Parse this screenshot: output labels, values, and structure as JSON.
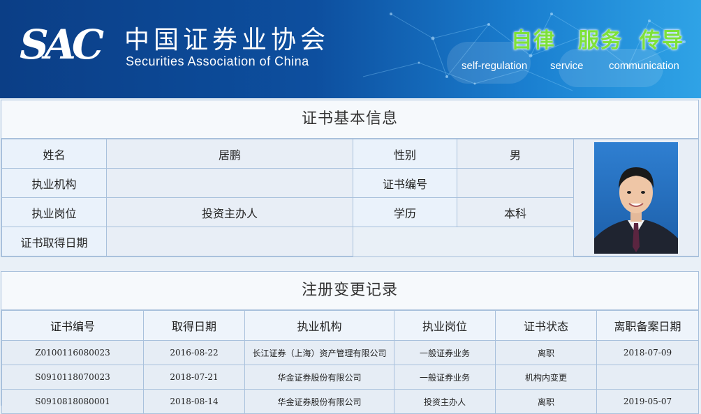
{
  "header": {
    "logo_text": "SAC",
    "org_name_cn": "中国证券业协会",
    "org_name_en": "Securities Association of China",
    "slogans": [
      {
        "cn": "自律",
        "en": "self-regulation"
      },
      {
        "cn": "服务",
        "en": "service"
      },
      {
        "cn": "传导",
        "en": "communication"
      }
    ],
    "colors": {
      "bg_dark": "#0b3e86",
      "bg_light": "#2fa3e6",
      "slogan_green": "#7ee13a"
    }
  },
  "certificate": {
    "title": "证书基本信息",
    "labels": {
      "name": "姓名",
      "gender": "性别",
      "institution": "执业机构",
      "cert_no": "证书编号",
      "position": "执业岗位",
      "education": "学历",
      "cert_date": "证书取得日期"
    },
    "values": {
      "name": "居鹏",
      "gender": "男",
      "institution": "",
      "cert_no": "",
      "position": "投资主办人",
      "education": "本科",
      "cert_date": ""
    },
    "photo_icon": "person-photo"
  },
  "registration": {
    "title": "注册变更记录",
    "columns": [
      "证书编号",
      "取得日期",
      "执业机构",
      "执业岗位",
      "证书状态",
      "离职备案日期"
    ],
    "rows": [
      [
        "Z0100116080023",
        "2016-08-22",
        "长江证券（上海）资产管理有限公司",
        "一般证券业务",
        "离职",
        "2018-07-09"
      ],
      [
        "S0910118070023",
        "2018-07-21",
        "华金证券股份有限公司",
        "一般证券业务",
        "机构内变更",
        ""
      ],
      [
        "S0910818080001",
        "2018-08-14",
        "华金证券股份有限公司",
        "投资主办人",
        "离职",
        "2019-05-07"
      ]
    ]
  }
}
